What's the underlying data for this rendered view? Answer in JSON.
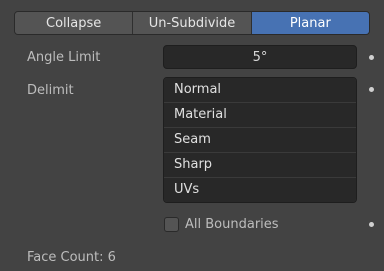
{
  "tabs": [
    {
      "label": "Collapse",
      "active": false
    },
    {
      "label": "Un-Subdivide",
      "active": false
    },
    {
      "label": "Planar",
      "active": true
    }
  ],
  "angle_limit": {
    "label": "Angle Limit",
    "value": "5°"
  },
  "delimit": {
    "label": "Delimit",
    "options": [
      "Normal",
      "Material",
      "Seam",
      "Sharp",
      "UVs"
    ]
  },
  "all_boundaries": {
    "label": "All Boundaries",
    "checked": false
  },
  "status": {
    "face_count": "Face Count: 6"
  },
  "colors": {
    "accent": "#4772b3",
    "background": "#434343",
    "field": "#282828"
  }
}
